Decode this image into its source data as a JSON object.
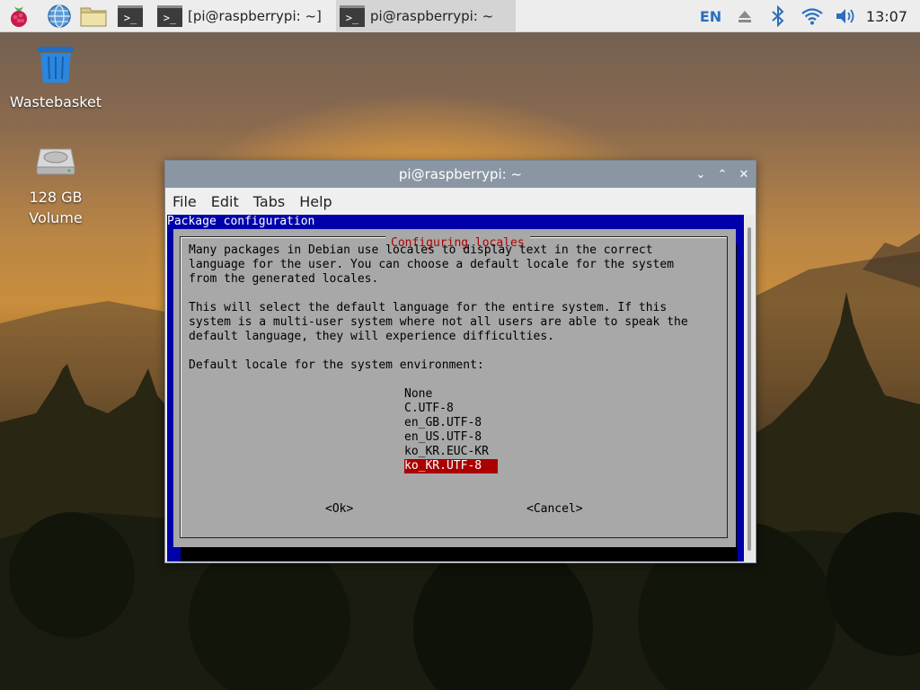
{
  "taskbar": {
    "tasks": [
      {
        "label": "[pi@raspberrypi: ~]",
        "active": false
      },
      {
        "label": "pi@raspberrypi: ~",
        "active": true
      }
    ],
    "language": "EN",
    "clock": "13:07",
    "icons": [
      "raspberry-menu-icon",
      "web-browser-icon",
      "file-manager-icon",
      "terminal-icon",
      "eject-icon",
      "bluetooth-icon",
      "wifi-icon",
      "volume-icon"
    ]
  },
  "desktop": {
    "icons": [
      {
        "label": "Wastebasket"
      },
      {
        "label_line1": "128 GB",
        "label_line2": "Volume"
      }
    ]
  },
  "window": {
    "title": "pi@raspberrypi: ~",
    "controls": {
      "minimize": "⌄",
      "maximize": "⌃",
      "close": "✕"
    },
    "menu": [
      "File",
      "Edit",
      "Tabs",
      "Help"
    ]
  },
  "terminal": {
    "header": "Package configuration",
    "dialog": {
      "caption": "Configuring locales",
      "paragraph1": [
        "Many packages in Debian use locales to display text in the correct",
        "language for the user. You can choose a default locale for the system",
        "from the generated locales."
      ],
      "paragraph2": [
        "This will select the default language for the entire system. If this",
        "system is a multi-user system where not all users are able to speak the",
        "default language, they will experience difficulties."
      ],
      "prompt": "Default locale for the system environment:",
      "options": [
        "None",
        "C.UTF-8",
        "en_GB.UTF-8",
        "en_US.UTF-8",
        "ko_KR.EUC-KR",
        "ko_KR.UTF-8"
      ],
      "selected_option": "ko_KR.UTF-8",
      "ok_label": "<Ok>",
      "cancel_label": "<Cancel>"
    }
  },
  "colors": {
    "terminal_bg": "#0000aa",
    "dialog_bg": "#a8a8a8",
    "caption": "#b00000",
    "selection": "#aa0000",
    "titlebar": "#8a96a4",
    "tray_blue": "#2a6fbd"
  }
}
